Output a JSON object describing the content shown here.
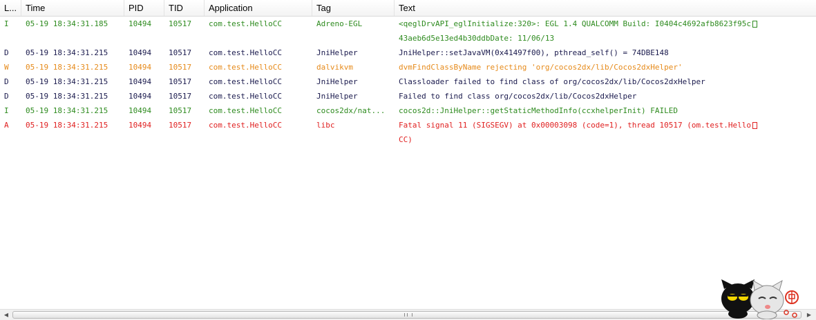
{
  "columns": {
    "level": "L...",
    "time": "Time",
    "pid": "PID",
    "tid": "TID",
    "app": "Application",
    "tag": "Tag",
    "text": "Text"
  },
  "colors": {
    "I": "#2e8b1f",
    "D": "#1a1a4d",
    "W": "#e68a1a",
    "A": "#e02020"
  },
  "rows": [
    {
      "level": "I",
      "time": "05-19 18:34:31.185",
      "pid": "10494",
      "tid": "10517",
      "app": "com.test.HelloCC",
      "tag": "Adreno-EGL",
      "text": "<qeglDrvAPI_eglInitialize:320>: EGL 1.4 QUALCOMM Build: I0404c4692afb8623f95c",
      "text2": "43aeb6d5e13ed4b30ddbDate: 11/06/13"
    },
    {
      "level": "D",
      "time": "05-19 18:34:31.215",
      "pid": "10494",
      "tid": "10517",
      "app": "com.test.HelloCC",
      "tag": "JniHelper",
      "text": "JniHelper::setJavaVM(0x41497f00), pthread_self() = 74DBE148"
    },
    {
      "level": "W",
      "time": "05-19 18:34:31.215",
      "pid": "10494",
      "tid": "10517",
      "app": "com.test.HelloCC",
      "tag": "dalvikvm",
      "text": "dvmFindClassByName rejecting 'org/cocos2dx/lib/Cocos2dxHelper'"
    },
    {
      "level": "D",
      "time": "05-19 18:34:31.215",
      "pid": "10494",
      "tid": "10517",
      "app": "com.test.HelloCC",
      "tag": "JniHelper",
      "text": "Classloader failed to find class of org/cocos2dx/lib/Cocos2dxHelper"
    },
    {
      "level": "D",
      "time": "05-19 18:34:31.215",
      "pid": "10494",
      "tid": "10517",
      "app": "com.test.HelloCC",
      "tag": "JniHelper",
      "text": "Failed to find class org/cocos2dx/lib/Cocos2dxHelper"
    },
    {
      "level": "I",
      "time": "05-19 18:34:31.215",
      "pid": "10494",
      "tid": "10517",
      "app": "com.test.HelloCC",
      "tag": "cocos2dx/nat...",
      "text": "cocos2d::JniHelper::getStaticMethodInfo(ccxhelperInit) FAILED"
    },
    {
      "level": "A",
      "time": "05-19 18:34:31.215",
      "pid": "10494",
      "tid": "10517",
      "app": "com.test.HelloCC",
      "tag": "libc",
      "text": "Fatal signal 11 (SIGSEGV) at 0x00003098 (code=1), thread 10517 (om.test.Hello",
      "text2": "CC)"
    }
  ],
  "scrollbar": {
    "left_arrow": "◀",
    "right_arrow": "▶"
  },
  "mascot": {
    "icon": "cartoon-cats-watermark"
  }
}
